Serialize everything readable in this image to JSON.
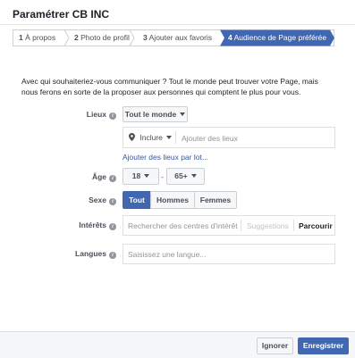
{
  "title": "Paramétrer CB INC",
  "steps": [
    {
      "num": "1",
      "label": "À propos"
    },
    {
      "num": "2",
      "label": "Photo de profil"
    },
    {
      "num": "3",
      "label": "Ajouter aux favoris"
    },
    {
      "num": "4",
      "label": "Audience de Page préférée"
    }
  ],
  "intro": "Avec qui souhaiteriez-vous communiquer ? Tout le monde peut trouver votre Page, mais nous ferons en sorte de la proposer aux personnes qui comptent le plus pour vous.",
  "lieux": {
    "label": "Lieux",
    "dropdown": "Tout le monde",
    "include": "Inclure",
    "placeholder": "Ajouter des lieux",
    "bulk_link": "Ajouter des lieux par lot..."
  },
  "age": {
    "label": "Âge",
    "min": "18",
    "dash": "-",
    "max": "65+"
  },
  "sexe": {
    "label": "Sexe",
    "options": [
      "Tout",
      "Hommes",
      "Femmes"
    ],
    "selected": "Tout"
  },
  "interets": {
    "label": "Intérêts",
    "placeholder": "Rechercher des centres d'intérêt",
    "suggestions": "Suggestions",
    "browse": "Parcourir"
  },
  "langues": {
    "label": "Langues",
    "placeholder": "Saisissez une langue..."
  },
  "footer": {
    "ignore": "Ignorer",
    "save": "Enregistrer"
  },
  "colors": {
    "accent": "#4267b2",
    "step_active": "#4267b2",
    "link": "#365899"
  }
}
